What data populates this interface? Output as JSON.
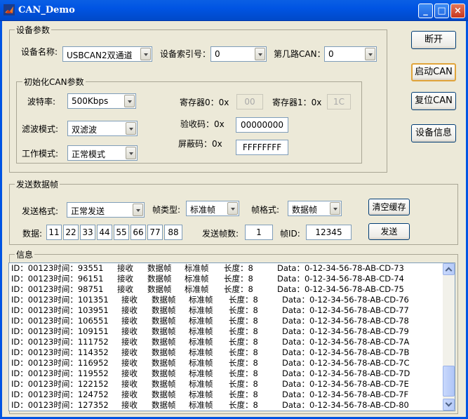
{
  "window": {
    "title": "CAN_Demo",
    "min": "_",
    "max": "□",
    "close": "×"
  },
  "device_group": {
    "legend": "设备参数",
    "device_name_label": "设备名称:",
    "device_name_value": "USBCAN2双通道",
    "device_index_label": "设备索引号：",
    "device_index_value": "0",
    "can_channel_label": "第几路CAN：",
    "can_channel_value": "0"
  },
  "init_group": {
    "legend": "初始化CAN参数",
    "baud_label": "波特率:",
    "baud_value": "500Kbps",
    "filter_label": "滤波模式:",
    "filter_value": "双滤波",
    "mode_label": "工作模式:",
    "mode_value": "正常模式",
    "reg0_label": "寄存器0：0x",
    "reg0_value": "00",
    "reg1_label": "寄存器1：0x",
    "reg1_value": "1C",
    "acc_code_label": "验收码：0x",
    "acc_code_value": "00000000",
    "mask_label": "屏蔽码：0x",
    "mask_value": "FFFFFFFF"
  },
  "right_buttons": {
    "open": "断开",
    "start": "启动CAN",
    "reset": "复位CAN",
    "info": "设备信息"
  },
  "send_group": {
    "legend": "发送数据帧",
    "send_format_label": "发送格式:",
    "send_format_value": "正常发送",
    "frame_type_label": "帧类型:",
    "frame_type_value": "标准帧",
    "frame_format_label": "帧格式:",
    "frame_format_value": "数据帧",
    "clear_button": "清空缓存",
    "data_label": "数据:",
    "data_bytes": [
      "11",
      "22",
      "33",
      "44",
      "55",
      "66",
      "77",
      "88"
    ],
    "count_label": "发送帧数:",
    "count_value": "1",
    "id_label": "帧ID:",
    "id_value": "12345",
    "send_button": "发送"
  },
  "info_group": {
    "legend": "信息",
    "rows": [
      [
        "ID：00123时间：93551",
        "接收",
        "数据帧",
        "标准帧",
        "长度：8",
        "Data：0-12-34-56-78-AB-CD-73"
      ],
      [
        "ID：00123时间：96151",
        "接收",
        "数据帧",
        "标准帧",
        "长度：8",
        "Data：0-12-34-56-78-AB-CD-74"
      ],
      [
        "ID：00123时间：98751",
        "接收",
        "数据帧",
        "标准帧",
        "长度：8",
        "Data：0-12-34-56-78-AB-CD-75"
      ],
      [
        "ID：00123时间：101351",
        "接收",
        "数据帧",
        "标准帧",
        "长度：8",
        "Data：0-12-34-56-78-AB-CD-76"
      ],
      [
        "ID：00123时间：103951",
        "接收",
        "数据帧",
        "标准帧",
        "长度：8",
        "Data：0-12-34-56-78-AB-CD-77"
      ],
      [
        "ID：00123时间：106551",
        "接收",
        "数据帧",
        "标准帧",
        "长度：8",
        "Data：0-12-34-56-78-AB-CD-78"
      ],
      [
        "ID：00123时间：109151",
        "接收",
        "数据帧",
        "标准帧",
        "长度：8",
        "Data：0-12-34-56-78-AB-CD-79"
      ],
      [
        "ID：00123时间：111752",
        "接收",
        "数据帧",
        "标准帧",
        "长度：8",
        "Data：0-12-34-56-78-AB-CD-7A"
      ],
      [
        "ID：00123时间：114352",
        "接收",
        "数据帧",
        "标准帧",
        "长度：8",
        "Data：0-12-34-56-78-AB-CD-7B"
      ],
      [
        "ID：00123时间：116952",
        "接收",
        "数据帧",
        "标准帧",
        "长度：8",
        "Data：0-12-34-56-78-AB-CD-7C"
      ],
      [
        "ID：00123时间：119552",
        "接收",
        "数据帧",
        "标准帧",
        "长度：8",
        "Data：0-12-34-56-78-AB-CD-7D"
      ],
      [
        "ID：00123时间：122152",
        "接收",
        "数据帧",
        "标准帧",
        "长度：8",
        "Data：0-12-34-56-78-AB-CD-7E"
      ],
      [
        "ID：00123时间：124752",
        "接收",
        "数据帧",
        "标准帧",
        "长度：8",
        "Data：0-12-34-56-78-AB-CD-7F"
      ],
      [
        "ID：00123时间：127352",
        "接收",
        "数据帧",
        "标准帧",
        "长度：8",
        "Data：0-12-34-56-78-AB-CD-80"
      ]
    ]
  }
}
